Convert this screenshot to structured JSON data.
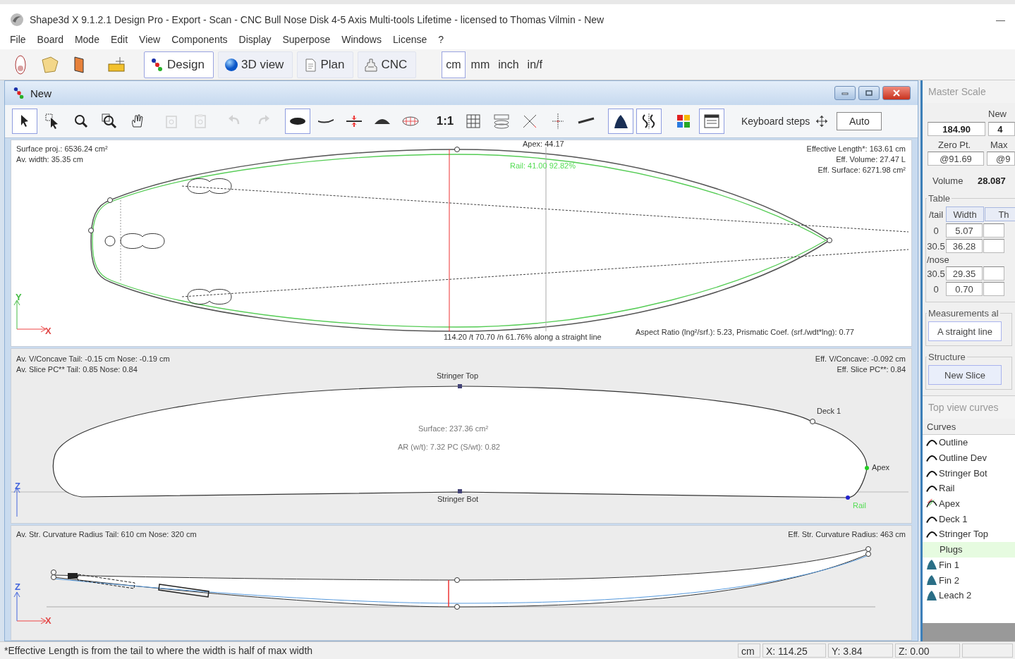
{
  "window": {
    "title": "Shape3d X 9.1.2.1 Design Pro - Export - Scan - CNC Bull Nose Disk 4-5 Axis Multi-tools Lifetime - licensed to Thomas Vilmin - New",
    "minimize": "—"
  },
  "menu": [
    "File",
    "Board",
    "Mode",
    "Edit",
    "View",
    "Components",
    "Display",
    "Superpose",
    "Windows",
    "License",
    "?"
  ],
  "modes": [
    {
      "label": "Design",
      "selected": true
    },
    {
      "label": "3D view",
      "selected": false
    },
    {
      "label": "Plan",
      "selected": false
    },
    {
      "label": "CNC",
      "selected": false
    }
  ],
  "units": [
    {
      "label": "cm",
      "selected": true
    },
    {
      "label": "mm",
      "selected": false
    },
    {
      "label": "inch",
      "selected": false
    },
    {
      "label": "in/f",
      "selected": false
    }
  ],
  "design_window": {
    "title": "New",
    "tools": [
      {
        "on": true,
        "disabled": false
      },
      {
        "on": false,
        "disabled": false
      },
      {
        "on": false,
        "disabled": false
      },
      {
        "on": false,
        "disabled": false
      },
      {
        "on": false,
        "disabled": false
      },
      {
        "on": false,
        "disabled": true
      },
      {
        "on": false,
        "disabled": true
      },
      {
        "on": false,
        "disabled": true
      },
      {
        "on": false,
        "disabled": true
      },
      {
        "on": true,
        "disabled": false
      },
      {
        "on": false,
        "disabled": false
      },
      {
        "on": false,
        "disabled": false
      },
      {
        "on": false,
        "disabled": false
      },
      {
        "on": false,
        "disabled": false
      },
      {
        "on": false,
        "disabled": false,
        "label": "1:1"
      },
      {
        "on": false,
        "disabled": false
      },
      {
        "on": false,
        "disabled": false
      },
      {
        "on": false,
        "disabled": false
      },
      {
        "on": false,
        "disabled": false
      },
      {
        "on": false,
        "disabled": false
      },
      {
        "on": true,
        "disabled": false
      },
      {
        "on": true,
        "disabled": false
      },
      {
        "on": false,
        "disabled": false
      },
      {
        "on": true,
        "disabled": false
      }
    ],
    "keyboard_steps": "Keyboard steps",
    "auto": "Auto",
    "top_view": {
      "labels": [
        {
          "text": "Surface proj.: 6536.24 cm²",
          "color": "#333333"
        },
        {
          "text": "Av. width: 35.35 cm",
          "color": "#333333"
        },
        {
          "text": "Apex: 44.17",
          "color": "#333333"
        },
        {
          "text": "Rail: 41.00 92.82%",
          "color": "#55dd55"
        },
        {
          "text": "Effective Length*: 163.61 cm",
          "color": "#333333"
        },
        {
          "text": "Eff. Volume:  27.47 L",
          "color": "#333333"
        },
        {
          "text": "Eff. Surface: 6271.98 cm²",
          "color": "#333333"
        },
        {
          "text": "114.20 /t 70.70 /n 61.76% along a straight line",
          "color": "#333333"
        },
        {
          "text": "Aspect Ratio (lng²/srf.):  5.23, Prismatic Coef. (srf./wdt*lng):  0.77",
          "color": "#333333"
        },
        {
          "text": "Y",
          "color": "#44bb44"
        },
        {
          "text": "X",
          "color": "#e04848"
        }
      ]
    },
    "slice_view": {
      "labels": [
        {
          "text": "Av. V/Concave Tail: -0.15 cm Nose: -0.19 cm",
          "color": "#333333"
        },
        {
          "text": "Av. Slice PC** Tail: 0.85 Nose: 0.84",
          "color": "#333333"
        },
        {
          "text": "Eff. V/Concave: -0.092 cm",
          "color": "#333333"
        },
        {
          "text": "Eff. Slice PC**:  0.84",
          "color": "#333333"
        },
        {
          "text": "Stringer Top",
          "color": "#333333"
        },
        {
          "text": "Deck 1",
          "color": "#333333"
        },
        {
          "text": "Surface: 237.36 cm²",
          "color": "#777777"
        },
        {
          "text": "AR (w/t): 7.32 PC (S/wt): 0.82",
          "color": "#777777"
        },
        {
          "text": "Apex",
          "color": "#333333"
        },
        {
          "text": "Stringer Bot",
          "color": "#333333"
        },
        {
          "text": "Rail",
          "color": "#55dd55"
        },
        {
          "text": "Z",
          "color": "#4466dd"
        }
      ]
    },
    "profile_view": {
      "labels": [
        {
          "text": "Av. Str. Curvature Radius Tail: 610 cm Nose: 320 cm",
          "color": "#333333"
        },
        {
          "text": "Eff. Str. Curvature Radius: 463 cm",
          "color": "#333333"
        },
        {
          "text": "Z",
          "color": "#4466dd"
        },
        {
          "text": "X",
          "color": "#e04848"
        }
      ]
    }
  },
  "side_panel": {
    "master_scale": {
      "title": "Master Scale",
      "column": "New",
      "value": "184.90",
      "value_2": "4",
      "zero_label": "Zero Pt.",
      "max_label": "Max",
      "zero_value": "@91.69",
      "max_value": "@9",
      "volume_label": "Volume",
      "volume": "28.087"
    },
    "table": {
      "title": "Table",
      "tail_label": "/tail",
      "columns": [
        "Width",
        "Th"
      ],
      "tail_rows": [
        [
          "0",
          "5.07"
        ],
        [
          "30.5",
          "36.28"
        ]
      ],
      "nose_label": "/nose",
      "nose_rows": [
        [
          "30.5",
          "29.35"
        ],
        [
          "0",
          "0.70"
        ]
      ]
    },
    "measurements": {
      "title": "Measurements al",
      "button": "A straight line"
    },
    "structure": {
      "title": "Structure",
      "button": "New Slice"
    },
    "curves_title": "Top view curves",
    "curves_header": "Curves",
    "curves": [
      {
        "label": "Outline",
        "kind": "curve",
        "selected": false
      },
      {
        "label": "Outline Dev",
        "kind": "curve",
        "selected": false
      },
      {
        "label": "Stringer Bot",
        "kind": "curve",
        "selected": false
      },
      {
        "label": "Rail",
        "kind": "curve",
        "selected": false
      },
      {
        "label": "Apex",
        "kind": "apex",
        "selected": false
      },
      {
        "label": "Deck 1",
        "kind": "curve",
        "selected": false
      },
      {
        "label": "Stringer Top",
        "kind": "curve",
        "selected": false
      },
      {
        "label": "Plugs",
        "kind": "group",
        "selected": true
      },
      {
        "label": "Fin 1",
        "kind": "fin",
        "selected": false
      },
      {
        "label": "Fin 2",
        "kind": "fin",
        "selected": false
      },
      {
        "label": "Leach 2",
        "kind": "fin",
        "selected": false
      }
    ]
  },
  "status_bar": {
    "note": "*Effective Length is from the tail to where the width is half of max width",
    "unit": "cm",
    "x": "X: 114.25",
    "y": "Y: 3.84",
    "z": "Z: 0.00"
  }
}
